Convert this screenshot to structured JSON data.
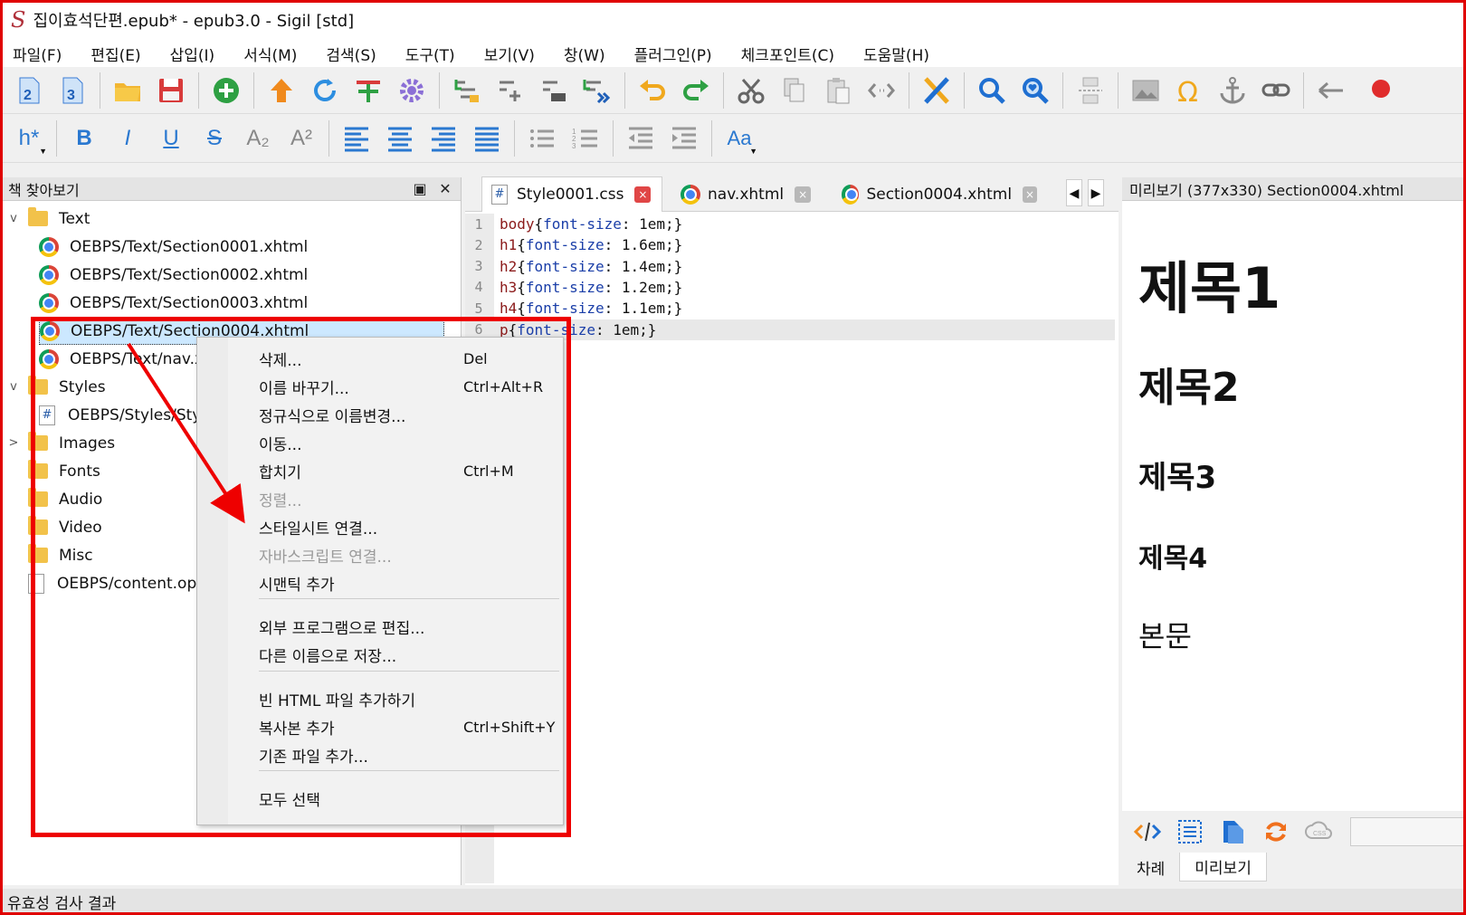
{
  "window": {
    "title": "집이효석단편.epub* - epub3.0 - Sigil [std]",
    "logo": "S"
  },
  "menubar": [
    "파일(F)",
    "편집(E)",
    "삽입(I)",
    "서식(M)",
    "검색(S)",
    "도구(T)",
    "보기(V)",
    "창(W)",
    "플러그인(P)",
    "체크포인트(C)",
    "도움말(H)"
  ],
  "format_toolbar": {
    "heading": "h*",
    "bold": "B",
    "italic": "I",
    "underline": "U",
    "strike": "S",
    "sub": "A₂",
    "sup": "A²",
    "case": "Aa"
  },
  "book_browser": {
    "title": "책 찾아보기",
    "restore": "▣",
    "close": "✕",
    "items": [
      {
        "label": "Text",
        "type": "folder",
        "expanded": "v"
      },
      {
        "label": "OEBPS/Text/Section0001.xhtml",
        "type": "xhtml"
      },
      {
        "label": "OEBPS/Text/Section0002.xhtml",
        "type": "xhtml"
      },
      {
        "label": "OEBPS/Text/Section0003.xhtml",
        "type": "xhtml"
      },
      {
        "label": "OEBPS/Text/Section0004.xhtml",
        "type": "xhtml",
        "selected": true
      },
      {
        "label": "OEBPS/Text/nav.xhtml",
        "type": "xhtml"
      },
      {
        "label": "Styles",
        "type": "folder",
        "expanded": "v"
      },
      {
        "label": "OEBPS/Styles/Style0001.css",
        "type": "css"
      },
      {
        "label": "Images",
        "type": "folder",
        "expanded": ">"
      },
      {
        "label": "Fonts",
        "type": "folder"
      },
      {
        "label": "Audio",
        "type": "folder"
      },
      {
        "label": "Video",
        "type": "folder"
      },
      {
        "label": "Misc",
        "type": "folder"
      },
      {
        "label": "OEBPS/content.opf",
        "type": "doc"
      }
    ]
  },
  "editor": {
    "tabs": [
      {
        "label": "Style0001.css",
        "icon": "#"
      },
      {
        "label": "nav.xhtml"
      },
      {
        "label": "Section0004.xhtml"
      }
    ],
    "tab_close": "×",
    "nav_prev": "◀",
    "nav_next": "▶",
    "lines": [
      {
        "n": "1",
        "sel": "body",
        "prop": "font-size",
        "val": " 1em;}"
      },
      {
        "n": "2",
        "sel": "h1",
        "prop": "font-size",
        "val": " 1.6em;}"
      },
      {
        "n": "3",
        "sel": "h2",
        "prop": "font-size",
        "val": " 1.4em;}"
      },
      {
        "n": "4",
        "sel": "h3",
        "prop": "font-size",
        "val": " 1.2em;}"
      },
      {
        "n": "5",
        "sel": "h4",
        "prop": "font-size",
        "val": " 1.1em;}"
      },
      {
        "n": "6",
        "sel": "p",
        "prop": "font-size",
        "val": " 1em;}"
      }
    ]
  },
  "preview": {
    "title": "미리보기 (377x330) Section0004.xhtml",
    "h1": "제목1",
    "h2": "제목2",
    "h3": "제목3",
    "h4": "제목4",
    "p": "본문",
    "tabs": [
      "차례",
      "미리보기"
    ]
  },
  "context_menu": {
    "items": [
      {
        "label": "삭제...",
        "shortcut": "Del"
      },
      {
        "label": "이름 바꾸기...",
        "shortcut": "Ctrl+Alt+R"
      },
      {
        "label": "정규식으로 이름변경...",
        "shortcut": ""
      },
      {
        "label": "이동...",
        "shortcut": ""
      },
      {
        "label": "합치기",
        "shortcut": "Ctrl+M"
      },
      {
        "label": "정렬...",
        "shortcut": "",
        "disabled": true
      },
      {
        "label": "스타일시트 연결...",
        "shortcut": ""
      },
      {
        "label": "자바스크립트 연결...",
        "shortcut": "",
        "disabled": true
      },
      {
        "label": "시맨틱 추가",
        "shortcut": ""
      },
      {
        "label": "외부 프로그램으로 편집...",
        "shortcut": ""
      },
      {
        "label": "다른 이름으로 저장...",
        "shortcut": ""
      },
      {
        "label": "빈 HTML 파일 추가하기",
        "shortcut": ""
      },
      {
        "label": "복사본 추가",
        "shortcut": "Ctrl+Shift+Y"
      },
      {
        "label": "기존 파일 추가...",
        "shortcut": ""
      },
      {
        "label": "모두 선택",
        "shortcut": ""
      }
    ]
  },
  "statusbar": {
    "text": "유효성 검사 결과"
  },
  "colors": {
    "highlight": "#ee0000",
    "selection": "#cce8ff",
    "accent": "#2a78d0"
  }
}
